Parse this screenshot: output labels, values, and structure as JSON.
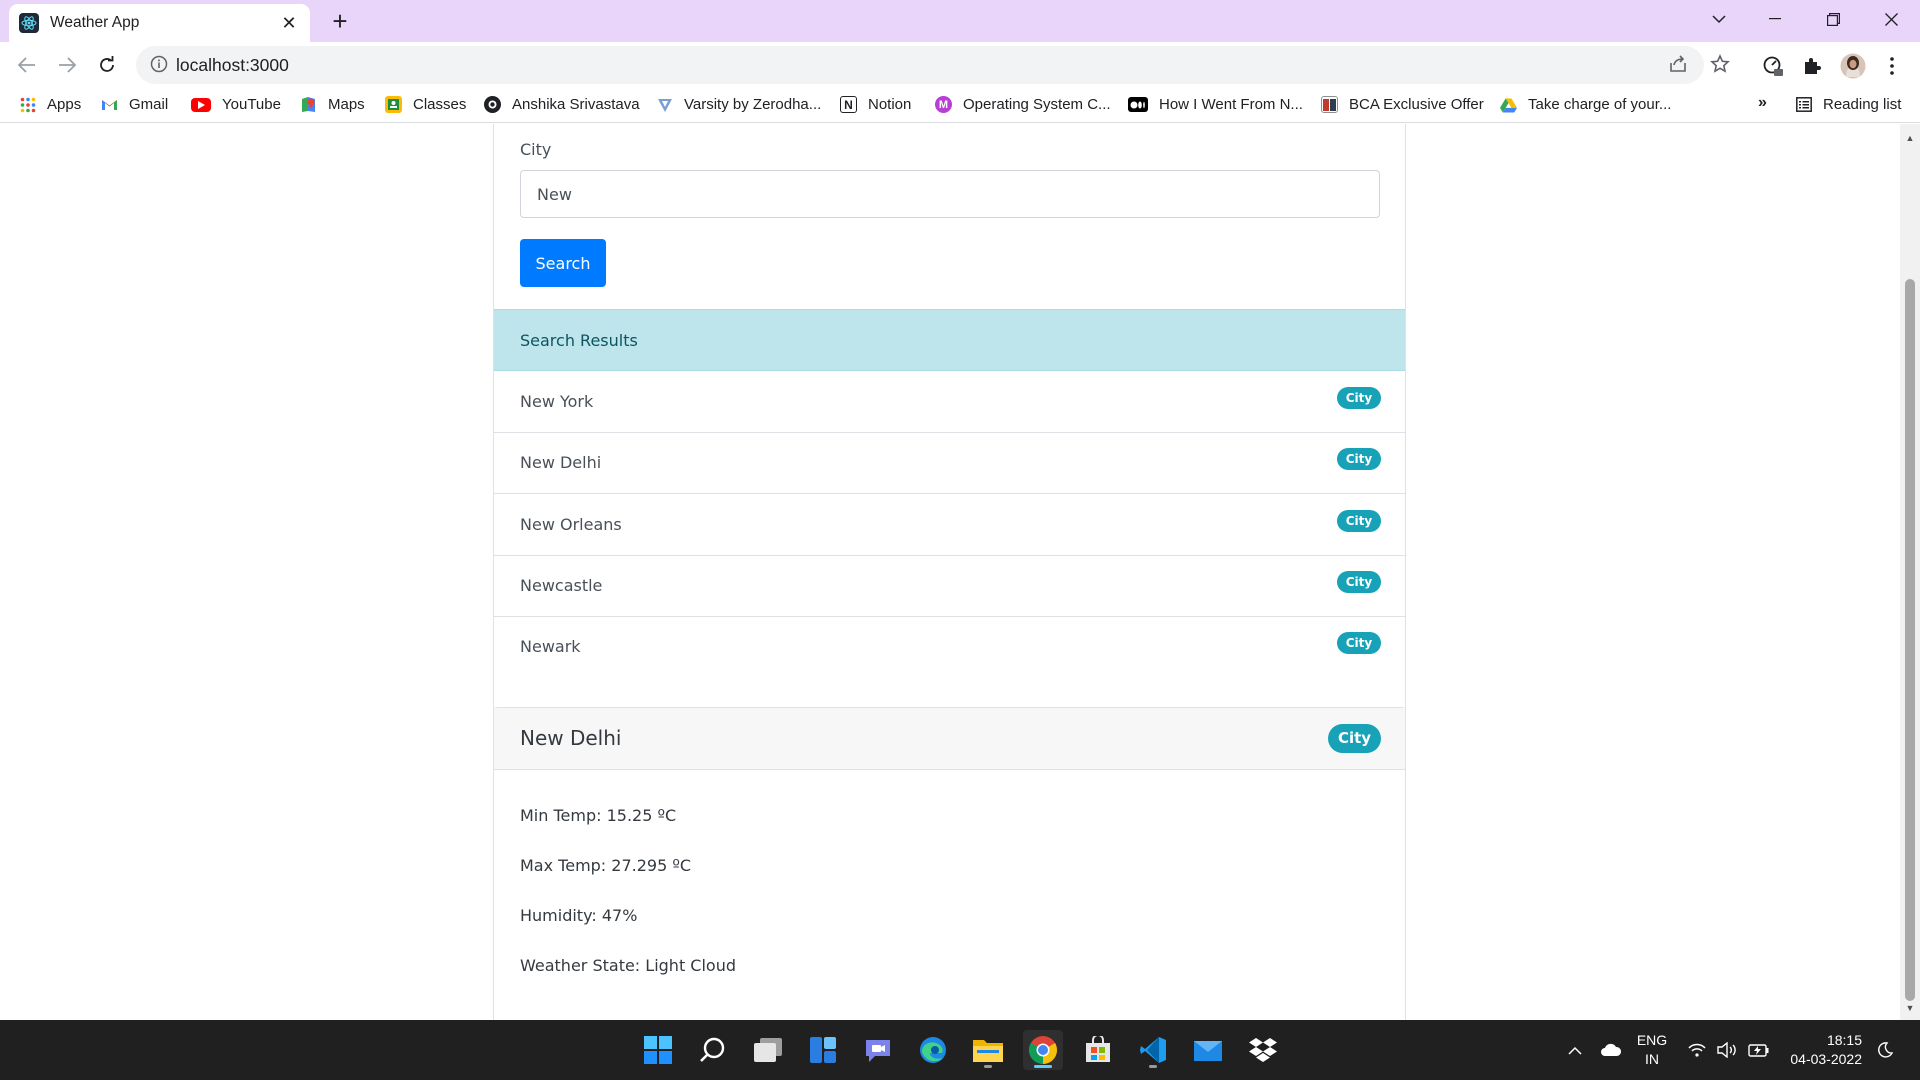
{
  "browser": {
    "tab_title": "Weather App",
    "url": "localhost:3000",
    "bookmarks": [
      {
        "label": "Apps",
        "icon": "apps-grid-icon"
      },
      {
        "label": "Gmail",
        "icon": "gmail-icon"
      },
      {
        "label": "YouTube",
        "icon": "youtube-icon"
      },
      {
        "label": "Maps",
        "icon": "maps-icon"
      },
      {
        "label": "Classes",
        "icon": "classroom-icon"
      },
      {
        "label": "Anshika Srivastava",
        "icon": "github-icon"
      },
      {
        "label": "Varsity by Zerodha...",
        "icon": "varsity-icon"
      },
      {
        "label": "Notion",
        "icon": "notion-icon"
      },
      {
        "label": "Operating System C...",
        "icon": "m-icon"
      },
      {
        "label": "How I Went From N...",
        "icon": "medium-icon"
      },
      {
        "label": "BCA Exclusive Offer",
        "icon": "offer-icon"
      },
      {
        "label": "Take charge of your...",
        "icon": "drive-icon"
      }
    ],
    "more_bookmarks": "»",
    "reading_list": "Reading list"
  },
  "page": {
    "city_label": "City",
    "city_input_value": "New",
    "search_button": "Search",
    "results_heading": "Search Results",
    "results": [
      {
        "name": "New York",
        "badge": "City"
      },
      {
        "name": "New Delhi",
        "badge": "City"
      },
      {
        "name": "New Orleans",
        "badge": "City"
      },
      {
        "name": "Newcastle",
        "badge": "City"
      },
      {
        "name": "Newark",
        "badge": "City"
      }
    ],
    "detail": {
      "title": "New Delhi",
      "badge": "City",
      "min_temp": "Min Temp: 15.25 ºC",
      "max_temp": "Max Temp: 27.295 ºC",
      "humidity": "Humidity: 47%",
      "weather_state": "Weather State: Light Cloud"
    }
  },
  "taskbar": {
    "language": "ENG",
    "region": "IN",
    "time": "18:15",
    "date": "04-03-2022",
    "apps": [
      "start-icon",
      "search-icon",
      "task-view-icon",
      "widgets-icon",
      "chat-icon",
      "edge-icon",
      "file-explorer-icon",
      "chrome-icon",
      "store-icon",
      "vscode-icon",
      "mail-icon",
      "dropbox-icon"
    ]
  },
  "colors": {
    "tab_strip": "#e9d5fa",
    "primary_button": "#007bff",
    "results_header": "#bee5eb",
    "badge": "#17a2b8"
  }
}
